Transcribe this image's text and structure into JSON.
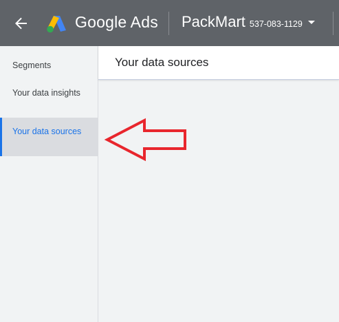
{
  "topbar": {
    "back_icon": "arrow-back-icon",
    "logo_icon": "google-ads-logo-icon",
    "product_name": "Google Ads",
    "account_name": "PackMart",
    "account_id": "537-083-1129",
    "account_menu_icon": "caret-down-icon"
  },
  "sidebar": {
    "items": [
      {
        "label": "Segments",
        "active": false
      },
      {
        "label": "Your data insights",
        "active": false
      },
      {
        "label": "Your data sources",
        "active": true
      }
    ]
  },
  "main": {
    "title": "Your data sources"
  },
  "annotation": {
    "icon": "left-arrow-outline-icon",
    "color": "#e8262d"
  },
  "colors": {
    "topbar": "#5f6368",
    "accent": "#1a73e8",
    "logo_blue": "#4285f4",
    "logo_yellow": "#fbbc04",
    "logo_green": "#34a853"
  }
}
